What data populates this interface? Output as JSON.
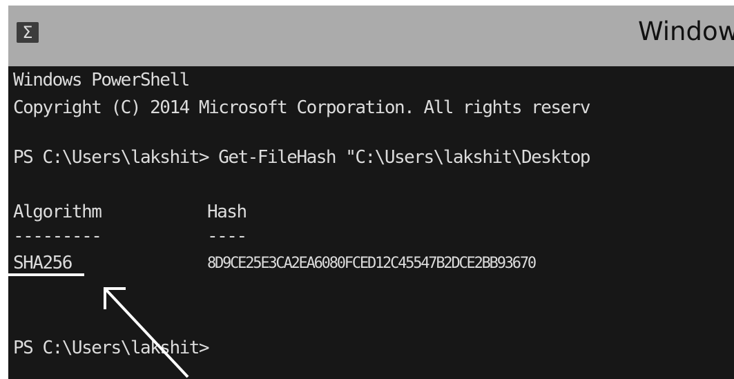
{
  "window": {
    "title": "Window",
    "icon": "powershell-icon"
  },
  "console": {
    "banner_line1": "Windows PowerShell",
    "banner_line2": "Copyright (C) 2014 Microsoft Corporation. All rights reserv",
    "command_line": "PS C:\\Users\\lakshit> Get-FileHash \"C:\\Users\\lakshit\\Desktop",
    "table": {
      "headers": [
        "Algorithm",
        "Hash"
      ],
      "separators": [
        "---------",
        "----"
      ],
      "rows": [
        {
          "algorithm": "SHA256",
          "hash": "8D9CE25E3CA2EA6080FCED12C45547B2DCE2BB93670"
        }
      ]
    },
    "prompt_line": "PS C:\\Users\\lakshit>"
  },
  "annotation": {
    "color": "#ffffff"
  }
}
